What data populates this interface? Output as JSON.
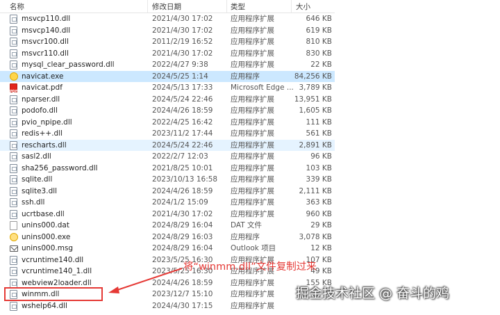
{
  "columns": {
    "name": "名称",
    "date": "修改日期",
    "type": "类型",
    "size": "大小"
  },
  "files": [
    {
      "name": "msvcp110.dll",
      "date": "2021/4/30 17:02",
      "type": "应用程序扩展",
      "size": "646 KB",
      "icon": "dll"
    },
    {
      "name": "msvcp140.dll",
      "date": "2021/4/30 17:02",
      "type": "应用程序扩展",
      "size": "619 KB",
      "icon": "dll"
    },
    {
      "name": "msvcr100.dll",
      "date": "2011/2/19 16:52",
      "type": "应用程序扩展",
      "size": "810 KB",
      "icon": "dll"
    },
    {
      "name": "msvcr110.dll",
      "date": "2021/4/30 17:02",
      "type": "应用程序扩展",
      "size": "830 KB",
      "icon": "dll"
    },
    {
      "name": "mysql_clear_password.dll",
      "date": "2022/4/27 9:38",
      "type": "应用程序扩展",
      "size": "22 KB",
      "icon": "dll"
    },
    {
      "name": "navicat.exe",
      "date": "2024/5/25 1:14",
      "type": "应用程序",
      "size": "84,256 KB",
      "icon": "exe"
    },
    {
      "name": "navicat.pdf",
      "date": "2024/5/13 17:33",
      "type": "Microsoft Edge ...",
      "size": "3,789 KB",
      "icon": "pdf"
    },
    {
      "name": "nparser.dll",
      "date": "2024/5/24 22:46",
      "type": "应用程序扩展",
      "size": "13,951 KB",
      "icon": "dll"
    },
    {
      "name": "podofo.dll",
      "date": "2024/4/26 18:59",
      "type": "应用程序扩展",
      "size": "1,605 KB",
      "icon": "dll"
    },
    {
      "name": "pvio_npipe.dll",
      "date": "2022/4/25 16:42",
      "type": "应用程序扩展",
      "size": "111 KB",
      "icon": "dll"
    },
    {
      "name": "redis++.dll",
      "date": "2023/11/2 17:44",
      "type": "应用程序扩展",
      "size": "561 KB",
      "icon": "dll"
    },
    {
      "name": "rescharts.dll",
      "date": "2024/5/24 22:46",
      "type": "应用程序扩展",
      "size": "2,891 KB",
      "icon": "dll"
    },
    {
      "name": "sasl2.dll",
      "date": "2022/2/7 12:03",
      "type": "应用程序扩展",
      "size": "96 KB",
      "icon": "dll"
    },
    {
      "name": "sha256_password.dll",
      "date": "2021/8/25 10:01",
      "type": "应用程序扩展",
      "size": "103 KB",
      "icon": "dll"
    },
    {
      "name": "sqlite.dll",
      "date": "2023/10/13 16:58",
      "type": "应用程序扩展",
      "size": "339 KB",
      "icon": "dll"
    },
    {
      "name": "sqlite3.dll",
      "date": "2024/4/26 18:59",
      "type": "应用程序扩展",
      "size": "2,111 KB",
      "icon": "dll"
    },
    {
      "name": "ssh.dll",
      "date": "2024/1/2 15:09",
      "type": "应用程序扩展",
      "size": "363 KB",
      "icon": "dll"
    },
    {
      "name": "ucrtbase.dll",
      "date": "2021/4/30 17:02",
      "type": "应用程序扩展",
      "size": "960 KB",
      "icon": "dll"
    },
    {
      "name": "unins000.dat",
      "date": "2024/8/29 16:04",
      "type": "DAT 文件",
      "size": "29 KB",
      "icon": "dat"
    },
    {
      "name": "unins000.exe",
      "date": "2024/8/29 16:03",
      "type": "应用程序",
      "size": "3,078 KB",
      "icon": "exe2"
    },
    {
      "name": "unins000.msg",
      "date": "2024/8/29 16:04",
      "type": "Outlook 项目",
      "size": "12 KB",
      "icon": "msg"
    },
    {
      "name": "vcruntime140.dll",
      "date": "2023/5/25 16:30",
      "type": "应用程序扩展",
      "size": "107 KB",
      "icon": "dll"
    },
    {
      "name": "vcruntime140_1.dll",
      "date": "2023/5/25 16:30",
      "type": "应用程序扩展",
      "size": "49 KB",
      "icon": "dll"
    },
    {
      "name": "webview2loader.dll",
      "date": "2024/4/26 18:59",
      "type": "应用程序扩展",
      "size": "155 KB",
      "icon": "dll"
    },
    {
      "name": "winmm.dll",
      "date": "2023/12/7 15:10",
      "type": "应用程序扩展",
      "size": "",
      "icon": "dll"
    },
    {
      "name": "wshelp64.dll",
      "date": "2024/4/30 17:15",
      "type": "应用程序扩展",
      "size": "",
      "icon": "dll"
    }
  ],
  "selected_index": 5,
  "highlight_index": 11,
  "annotation": "将“winmm.dll”文件复制过来",
  "watermark": "掘金技术社区 @ 奋斗的鸡",
  "colors": {
    "annotation": "#e53935",
    "selected": "#cce8ff"
  }
}
